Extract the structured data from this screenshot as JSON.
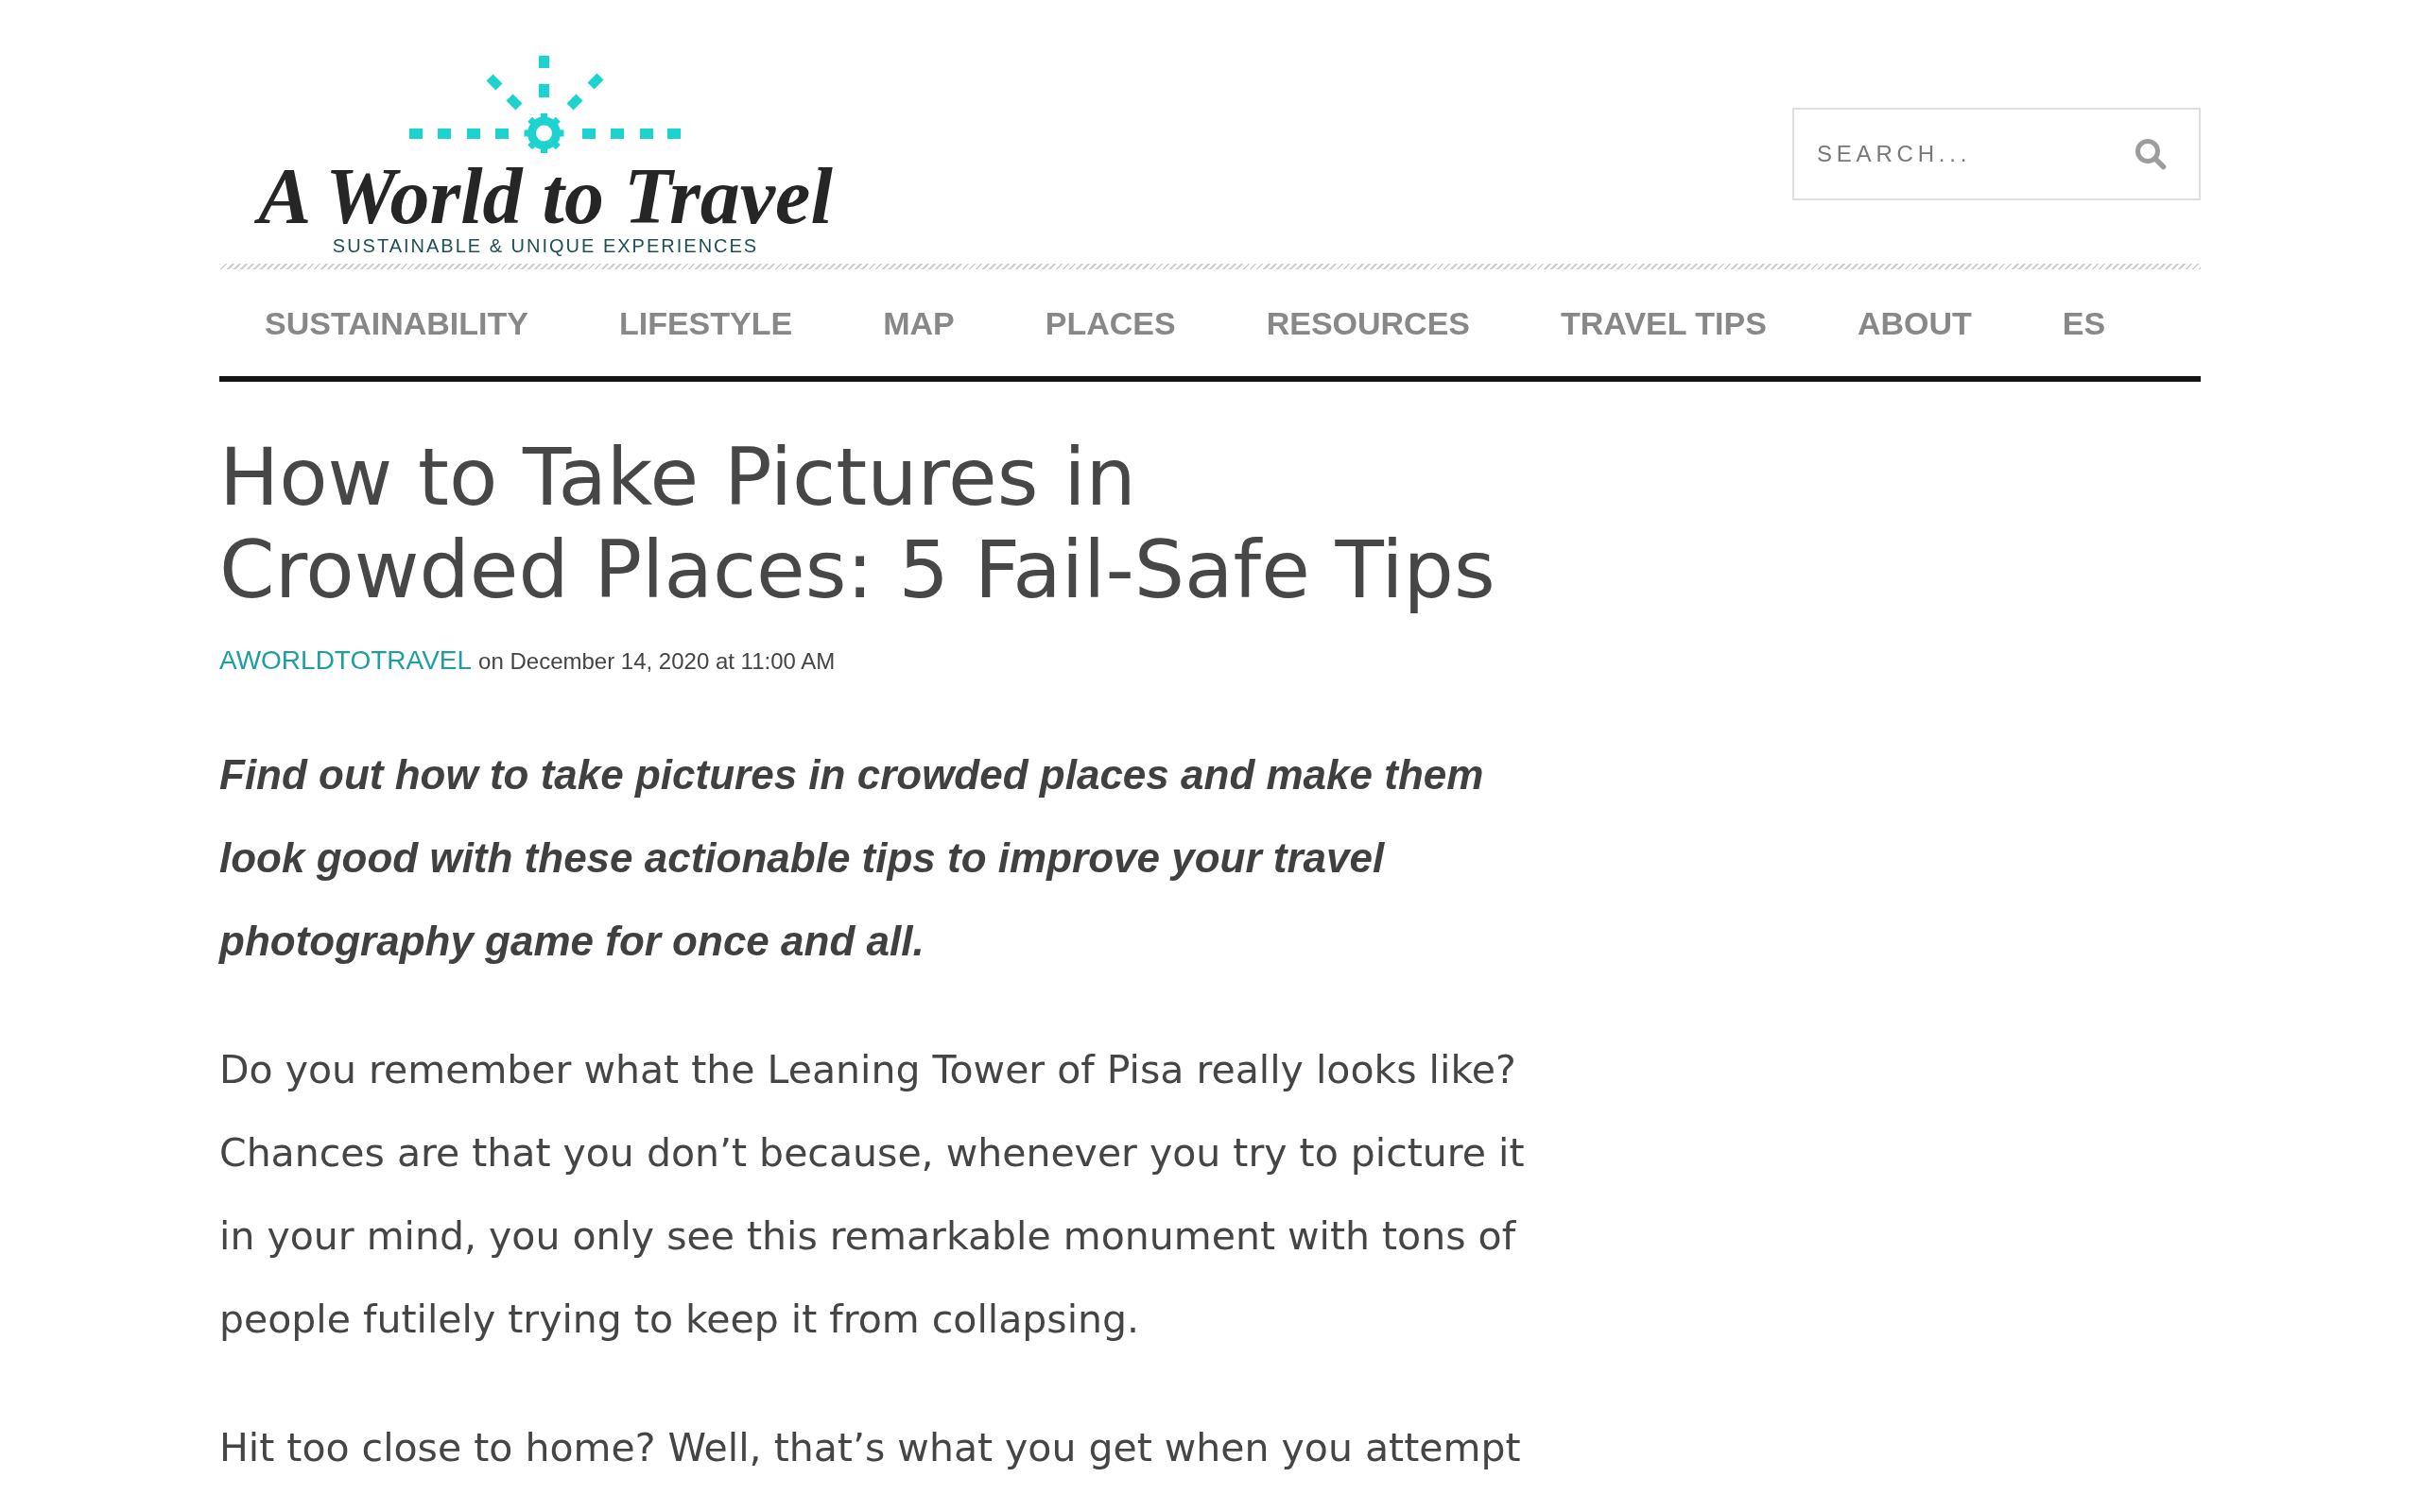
{
  "header": {
    "logo": {
      "title": "A World to Travel",
      "tagline": "SUSTAINABLE & UNIQUE EXPERIENCES"
    },
    "search": {
      "placeholder": "SEARCH..."
    }
  },
  "nav": {
    "items": [
      {
        "label": "SUSTAINABILITY"
      },
      {
        "label": "LIFESTYLE"
      },
      {
        "label": "MAP"
      },
      {
        "label": "PLACES"
      },
      {
        "label": "RESOURCES"
      },
      {
        "label": "TRAVEL TIPS"
      },
      {
        "label": "ABOUT"
      },
      {
        "label": "ES"
      }
    ]
  },
  "article": {
    "title": "How to Take Pictures in Crowded Places: 5 Fail-Safe Tips",
    "byline": {
      "author": "AWORLDTOTRAVEL",
      "date": "on December 14, 2020 at 11:00 AM"
    },
    "paragraphs": [
      {
        "kind": "lead",
        "text": "Find out how to take pictures in crowded places and make them look good with these actionable tips to improve your travel photography game for once and all."
      },
      {
        "kind": "body",
        "text": "Do you remember what the Leaning Tower of Pisa really looks like? Chances are that you don’t because, whenever you try to picture it in your mind, you only see this remarkable monument with tons of people futilely trying to keep it from collapsing."
      },
      {
        "kind": "body",
        "text": "Hit too close to home? Well, that’s what you get when you attempt"
      }
    ]
  }
}
